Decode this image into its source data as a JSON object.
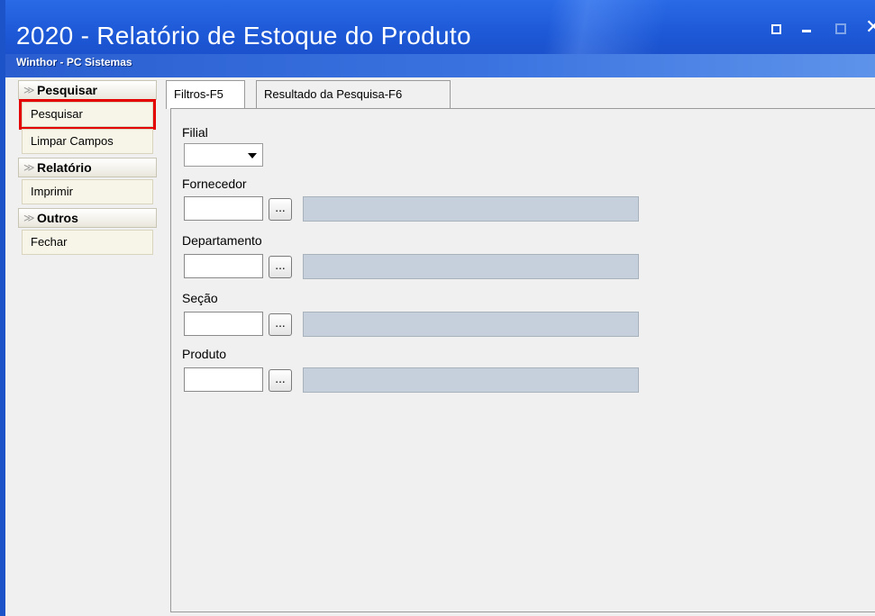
{
  "window": {
    "title": "2020 - Relatório de Estoque do Produto",
    "subtitle": "Winthor - PC Sistemas",
    "controls": {
      "close_label": "✕"
    }
  },
  "sidebar": {
    "groups": [
      {
        "header": "Pesquisar",
        "items": [
          {
            "label": "Pesquisar",
            "selected": true
          },
          {
            "label": "Limpar Campos",
            "selected": false
          }
        ]
      },
      {
        "header": "Relatório",
        "items": [
          {
            "label": "Imprimir",
            "selected": false
          }
        ]
      },
      {
        "header": "Outros",
        "items": [
          {
            "label": "Fechar",
            "selected": false
          }
        ]
      }
    ],
    "chevron": "≫"
  },
  "tabs": [
    {
      "label": "Filtros-F5",
      "active": true
    },
    {
      "label": "Resultado da Pesquisa-F6",
      "active": false
    }
  ],
  "filters": {
    "filial_label": "Filial",
    "filial_value": "",
    "fornecedor_label": "Fornecedor",
    "departamento_label": "Departamento",
    "secao_label": "Seção",
    "produto_label": "Produto",
    "lookup_button_label": "..."
  },
  "colors": {
    "titlebar": "#1d58d6",
    "highlight": "#e50000",
    "description_field": "#c5d0dc"
  }
}
